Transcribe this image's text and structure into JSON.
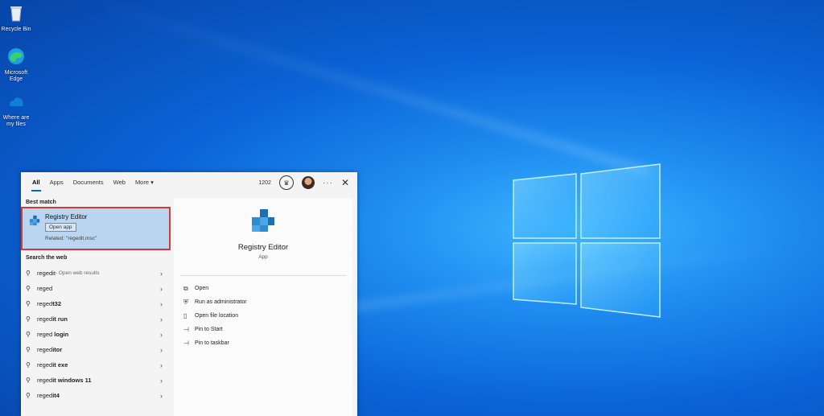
{
  "desktop": {
    "icons": [
      {
        "label": "Recycle Bin",
        "icon": "recycle-bin-icon"
      },
      {
        "label": "Microsoft Edge",
        "icon": "edge-icon"
      },
      {
        "label": "Where are my files",
        "icon": "onedrive-icon"
      }
    ]
  },
  "search_panel": {
    "tabs": [
      "All",
      "Apps",
      "Documents",
      "Web",
      "More ▾"
    ],
    "points": "1202",
    "more_dots": "···",
    "close": "✕",
    "best_match_heading": "Best match",
    "best_match": {
      "name": "Registry Editor",
      "open_label": "Open app",
      "related": "Related: \"regedit.msc\""
    },
    "web_heading": "Search the web",
    "web_results": [
      {
        "bold": "regedit",
        "sub": " - Open web results"
      },
      {
        "plain": "reged",
        "bold": ""
      },
      {
        "plain": "reged",
        "bold": "t32"
      },
      {
        "plain": "reged",
        "bold": "it run"
      },
      {
        "plain": "reged ",
        "bold": "login"
      },
      {
        "plain": "reged",
        "bold": "itor"
      },
      {
        "plain": "reged",
        "bold": "it exe"
      },
      {
        "plain": "reged",
        "bold": "it windows 11"
      },
      {
        "plain": "reged",
        "bold": "it4"
      }
    ],
    "preview": {
      "name": "Registry Editor",
      "type": "App",
      "actions": [
        {
          "label": "Open",
          "icon": "open-icon"
        },
        {
          "label": "Run as administrator",
          "icon": "admin-icon"
        },
        {
          "label": "Open file location",
          "icon": "file-location-icon"
        },
        {
          "label": "Pin to Start",
          "icon": "pin-icon"
        },
        {
          "label": "Pin to taskbar",
          "icon": "pin-icon"
        }
      ]
    }
  },
  "colors": {
    "accent": "#0067c0",
    "highlight": "#b9d5f0",
    "outline": "#d23b3b"
  }
}
